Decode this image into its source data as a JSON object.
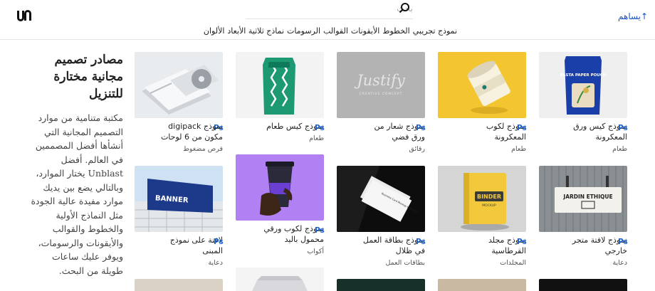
{
  "header": {
    "logo_text": "un",
    "search_placeholder": "بحث",
    "contribute_label": "↑يساهم"
  },
  "nav": [
    "الألوان",
    "نماذج ثلاثية الأبعاد",
    "الرسومات",
    "القوالب",
    "الأيقونات",
    "الخطوط",
    "نموذج تجريبي"
  ],
  "hero": {
    "title": "مصادر تصميم مجانية مختارة للتنزيل",
    "description": "مكتبة متنامية من موارد التصميم المجانية التي أنشأها أفضل المصممين في العالم. أفضل Unblast يختار الموارد، وبالتالي يضع بين يديك موارد مفيدة عالية الجودة مثل النماذج الأولية والخطوط والقوالب والأيقونات والرسومات، ويوفر عليك ساعات طويلة من البحث."
  },
  "badge": "Ps",
  "cards": [
    {
      "title": "نموذج digipack مكون من 6 لوحات",
      "category": "قرص مضغوط"
    },
    {
      "title": "نموذج كيس طعام",
      "category": "طعام"
    },
    {
      "title": "نموذج شعار من ورق فضي",
      "category": "رقائق"
    },
    {
      "title": "نموذج لكوب المعكرونة",
      "category": "طعام"
    },
    {
      "title": "نموذج كيس ورق المعكرونة",
      "category": "طعام"
    },
    {
      "title": "لافتة على نموذج المبنى",
      "category": "دعاية"
    },
    {
      "title": "نموذج لكوب ورقي محمول باليد",
      "category": "أكواب"
    },
    {
      "title": "نموذج بطاقة العمل في ظلال",
      "category": "بطاقات العمل"
    },
    {
      "title": "نموذج مجلد القرطاسية",
      "category": "المجلدات"
    },
    {
      "title": "نموذج لافتة متجر خارجي",
      "category": "دعاية"
    }
  ],
  "thumb_text": {
    "justify": "Justify",
    "creative": "CREATIVE CONCEPT",
    "pasta": "PASTA PAPER POUCH",
    "banner": "BANNER",
    "binder": "BINDER",
    "binder_sub": "MOCKUP",
    "jardin": "JARDIN ETHIQUE",
    "business": "Business Card Mockup Collection"
  },
  "colors": {
    "accent": "#1c63d6",
    "link": "#1a4fc4"
  }
}
